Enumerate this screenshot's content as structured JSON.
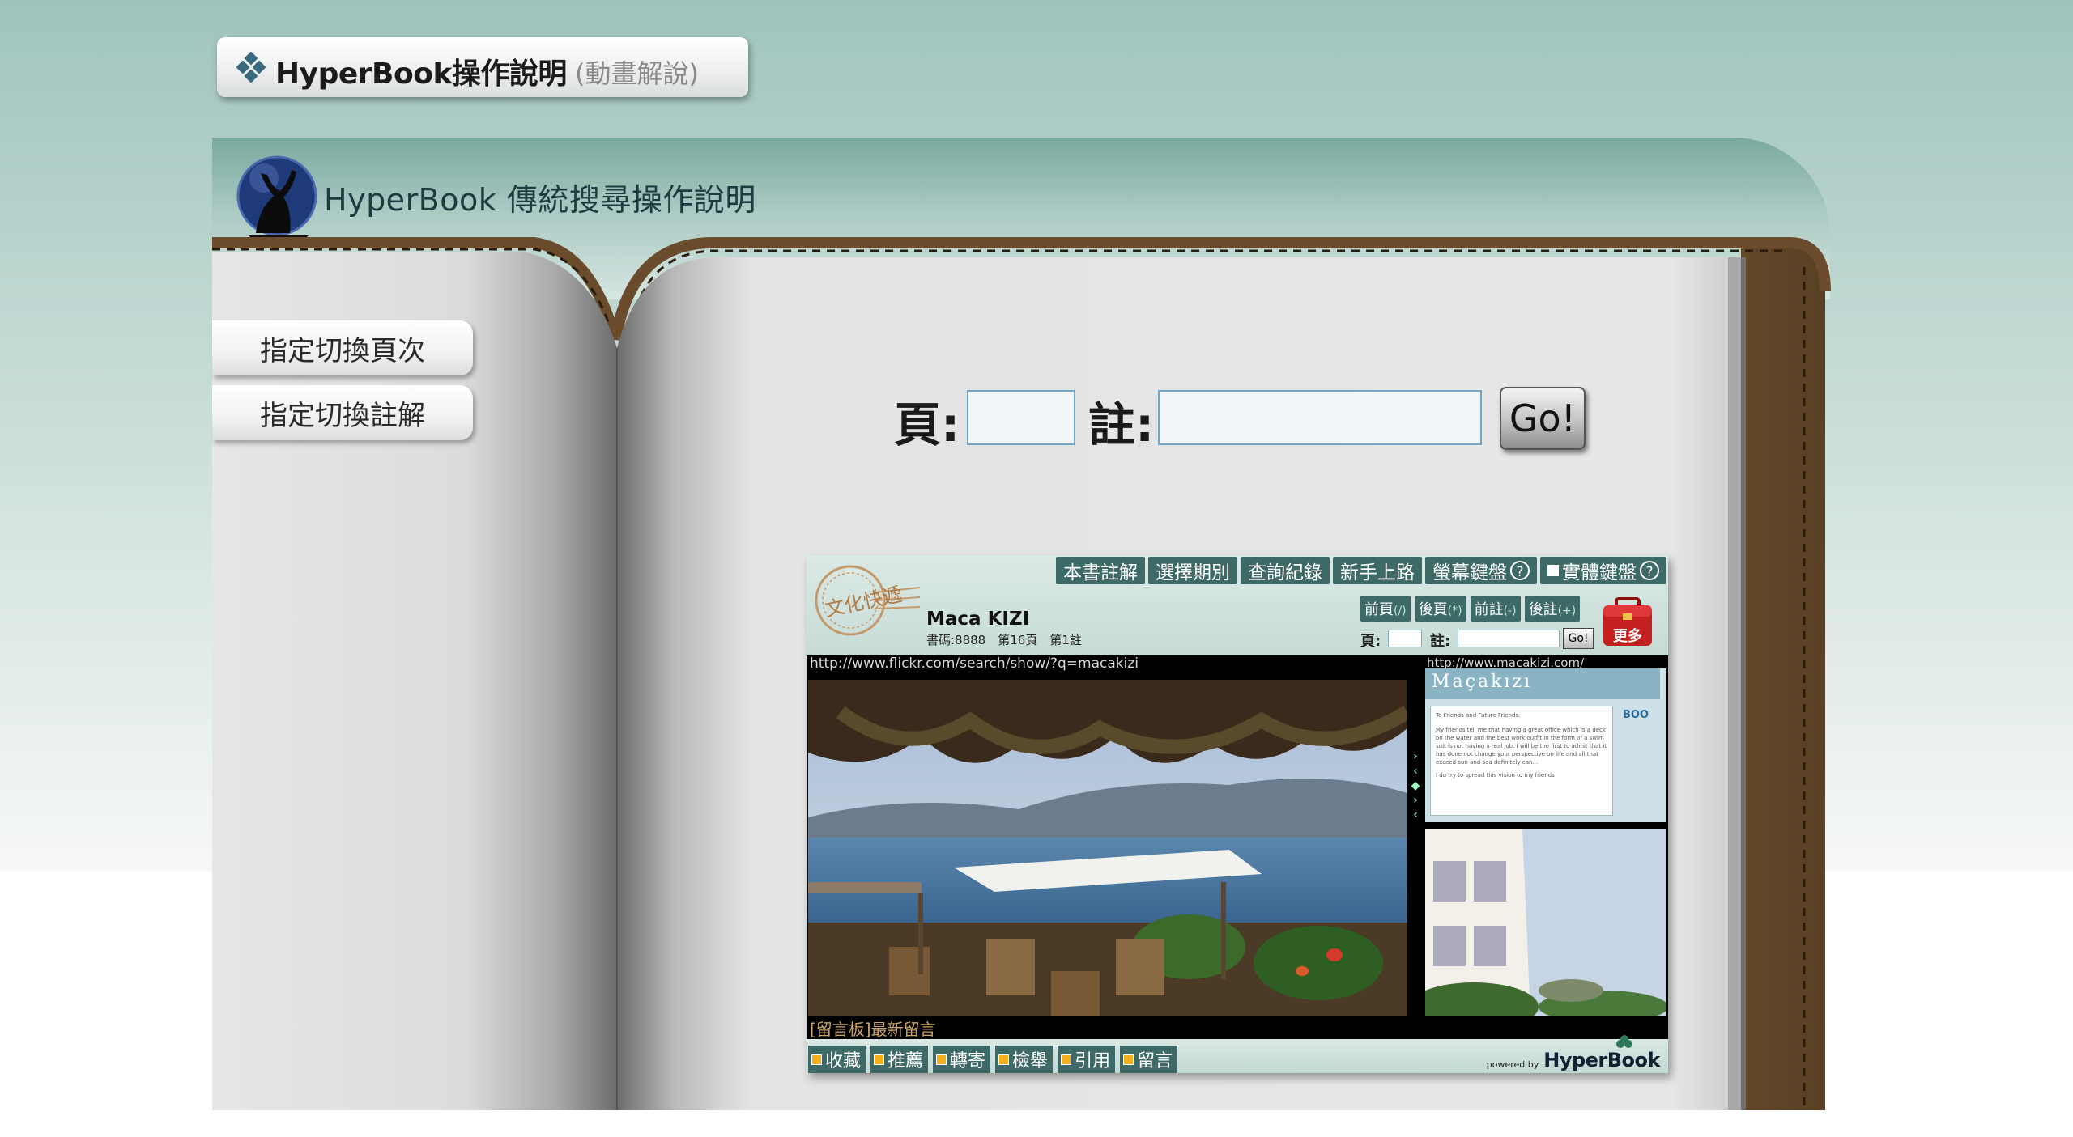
{
  "top_pill": {
    "title": "HyperBook操作說明",
    "subtitle": "(動畫解說)"
  },
  "header": {
    "title": "HyperBook 傳統搜尋操作說明"
  },
  "sidebar": {
    "items": [
      {
        "label": "指定切換頁次"
      },
      {
        "label": "指定切換註解"
      }
    ]
  },
  "form": {
    "page_label": "頁:",
    "note_label": "註:",
    "page_value": "",
    "note_value": "",
    "go_label": "Go!"
  },
  "preview": {
    "stamp_text": "文化快遞",
    "top_nav": [
      {
        "label": "本書註解"
      },
      {
        "label": "選擇期別"
      },
      {
        "label": "查詢紀錄"
      },
      {
        "label": "新手上路"
      },
      {
        "label": "螢幕鍵盤",
        "help": "?"
      },
      {
        "label": "實體鍵盤",
        "help": "?"
      }
    ],
    "book_title": "Maca KIZI",
    "book_meta": "書碼:8888　第16頁　第1註",
    "sub_nav": [
      {
        "label": "前頁",
        "hint": "(/)"
      },
      {
        "label": "後頁",
        "hint": "(*)"
      },
      {
        "label": "前註",
        "hint": "(-)"
      },
      {
        "label": "後註",
        "hint": "(+)"
      }
    ],
    "mini_page_label": "頁:",
    "mini_note_label": "註:",
    "mini_go": "Go!",
    "more_label": "更多",
    "left_url": "http://www.flickr.com/search/show/?q=macakizi",
    "right_url": "http://www.macakizi.com/",
    "brand": "Maçakızı",
    "welcome_title": "To Friends and Future Friends.",
    "welcome_body": "My friends tell me that having a great office which is a deck on the water and the best work outfit in the form of a swim suit is not having a real job. I will be the first to admit that it has done not change your perspective on life and all that exceed sun and sea definitely can...",
    "welcome_footer": "I do try to spread this vision to my friends",
    "boo_label": "BOO",
    "board_text": "[留言板]最新留言",
    "bottom_actions": [
      {
        "label": "收藏"
      },
      {
        "label": "推薦"
      },
      {
        "label": "轉寄"
      },
      {
        "label": "檢舉"
      },
      {
        "label": "引用"
      },
      {
        "label": "留言"
      }
    ],
    "powered_by": "powered by",
    "hb_logo": "HyperBook"
  },
  "colors": {
    "nav_bg": "#3d6a66",
    "input_border": "#6ea8c4",
    "book_leather": "#7a5a35",
    "header_band": "#a9c9c2"
  }
}
